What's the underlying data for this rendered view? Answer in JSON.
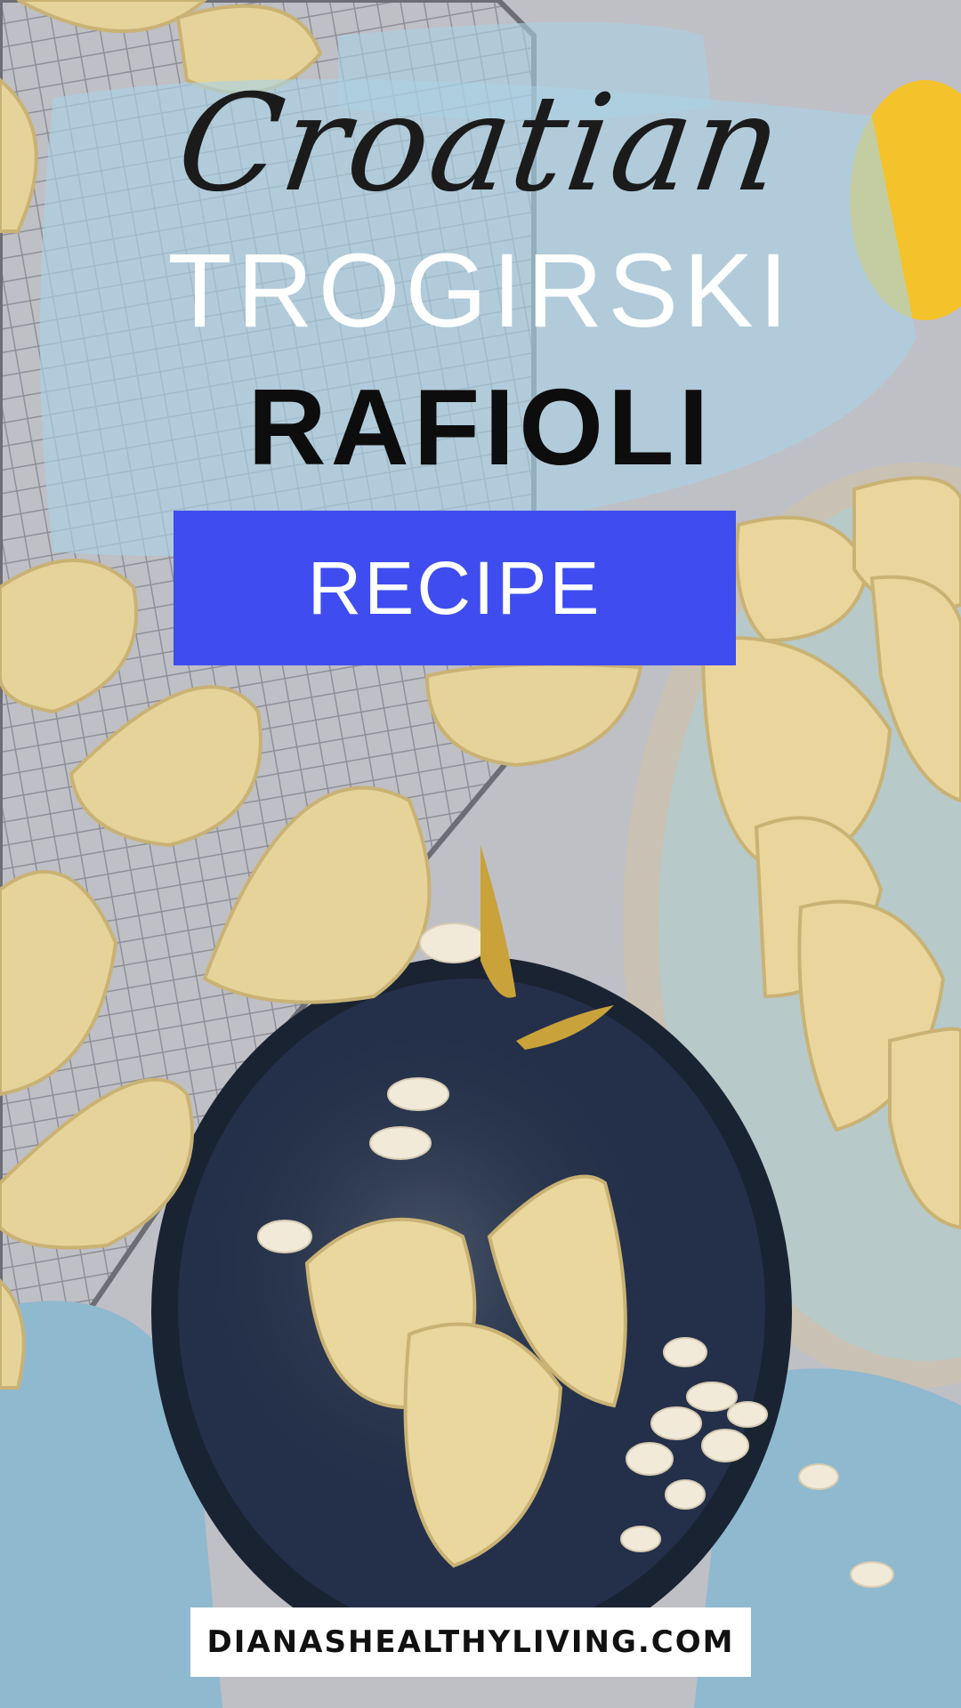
{
  "header": {
    "script_title": "Croatian",
    "title_line_1": "TROGIRSKI",
    "title_line_2": "RAFIOLI"
  },
  "badge": {
    "label": "RECIPE",
    "color": "#3f4df0"
  },
  "footer": {
    "site": "DIANASHEALTHYLIVING.COM"
  },
  "colors": {
    "background": "#bdbdc4",
    "watercolor": "#a9d3e6",
    "pastry": "#e9d69a",
    "dark_plate": "#1f2a3a",
    "large_plate": "#b7c9c8",
    "napkin": "#8fb9cf",
    "lemon": "#f4c22b"
  }
}
